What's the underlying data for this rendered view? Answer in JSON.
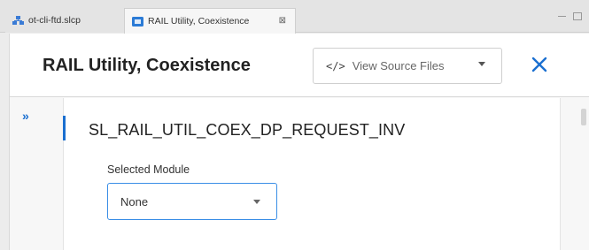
{
  "tabs": [
    {
      "label": "ot-cli-ftd.slcp",
      "icon": "project-icon",
      "active": false
    },
    {
      "label": "RAIL Utility, Coexistence",
      "icon": "component-icon",
      "active": true,
      "close": "⊠"
    }
  ],
  "header": {
    "title": "RAIL Utility, Coexistence",
    "view_source": {
      "icon": "</>",
      "label": "View Source Files"
    },
    "close_symbol": "✕"
  },
  "sidebar": {
    "expand_symbol": "»"
  },
  "section": {
    "title": "SL_RAIL_UTIL_COEX_DP_REQUEST_INV",
    "field_label": "Selected Module",
    "select_value": "None"
  },
  "colors": {
    "accent": "#1a6fd0",
    "select_border": "#3a8ee6"
  }
}
